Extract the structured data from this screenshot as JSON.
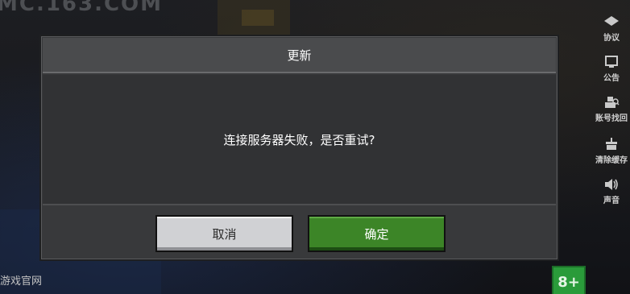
{
  "dialog": {
    "title": "更新",
    "message": "连接服务器失败，是否重试?",
    "cancel_label": "取消",
    "confirm_label": "确定"
  },
  "sidebar": {
    "items": [
      {
        "label": "协议",
        "icon": "agreement-icon"
      },
      {
        "label": "公告",
        "icon": "announcement-icon"
      },
      {
        "label": "账号找回",
        "icon": "account-recovery-icon"
      },
      {
        "label": "清除缓存",
        "icon": "clear-cache-icon"
      },
      {
        "label": "声音",
        "icon": "speaker-icon"
      }
    ]
  },
  "footer": {
    "site_label": "游戏官网",
    "age_rating": "8+"
  },
  "colors": {
    "confirm_green": "#3c8527",
    "cancel_gray": "#d0d1d4",
    "dialog_bg": "#38393b"
  }
}
